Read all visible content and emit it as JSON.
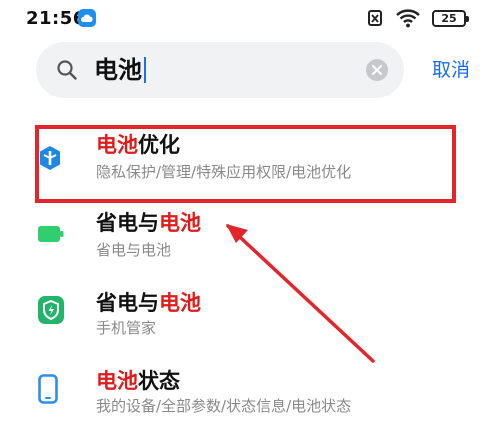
{
  "status_bar": {
    "time": "21:56",
    "battery": "25"
  },
  "search": {
    "query": "电池",
    "cancel_label": "取消"
  },
  "results": [
    {
      "title_highlight": "电池",
      "title_rest": "优化",
      "subtitle": "隐私保护/管理/特殊应用权限/电池优化",
      "icon": "shield-hexagon-icon",
      "icon_color": "#1e88e5"
    },
    {
      "title_plain": "省电与",
      "title_highlight": "电池",
      "subtitle": "省电与电池",
      "icon": "battery-icon",
      "icon_color": "#2fcf6e"
    },
    {
      "title_plain": "省电与",
      "title_highlight": "电池",
      "subtitle": "手机管家",
      "icon": "security-shield-icon",
      "icon_color": "#21b56a"
    },
    {
      "title_highlight": "电池",
      "title_rest": "状态",
      "subtitle": "我的设备/全部参数/状态信息/电池状态",
      "icon": "phone-icon",
      "icon_color": "#2e8ef0"
    }
  ],
  "colors": {
    "highlight": "#e11b1b",
    "accent": "#1e6cf5",
    "annotation": "#e2262b"
  }
}
